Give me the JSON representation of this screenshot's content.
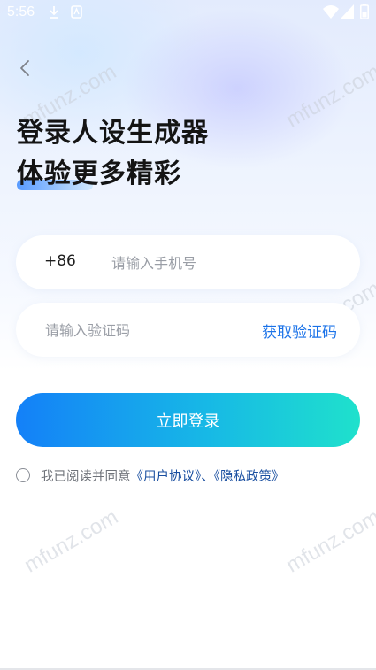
{
  "status_bar": {
    "time": "5:56"
  },
  "header": {
    "back_icon": "chevron-left-icon"
  },
  "headline": {
    "line1": "登录人设生成器",
    "line2": "体验更多精彩"
  },
  "phone_field": {
    "country_code": "+86",
    "placeholder": "请输入手机号",
    "value": ""
  },
  "code_field": {
    "placeholder": "请输入验证码",
    "value": "",
    "get_code_label": "获取验证码"
  },
  "login": {
    "label": "立即登录"
  },
  "agreement": {
    "checked": false,
    "prefix": "我已阅读并同意",
    "user_agreement": "《用户协议》",
    "separator": "、",
    "privacy_policy": "《隐私政策》"
  },
  "watermarks": [
    "mfunz.com",
    "mfunz.com",
    "mfunz.com",
    "mfunz.com",
    "mfunz.com"
  ],
  "colors": {
    "accent": "#1a72e8",
    "link": "#1a4fa0",
    "gradient_start": "#1480f8",
    "gradient_end": "#1fe1cc",
    "headline": "#141414"
  }
}
